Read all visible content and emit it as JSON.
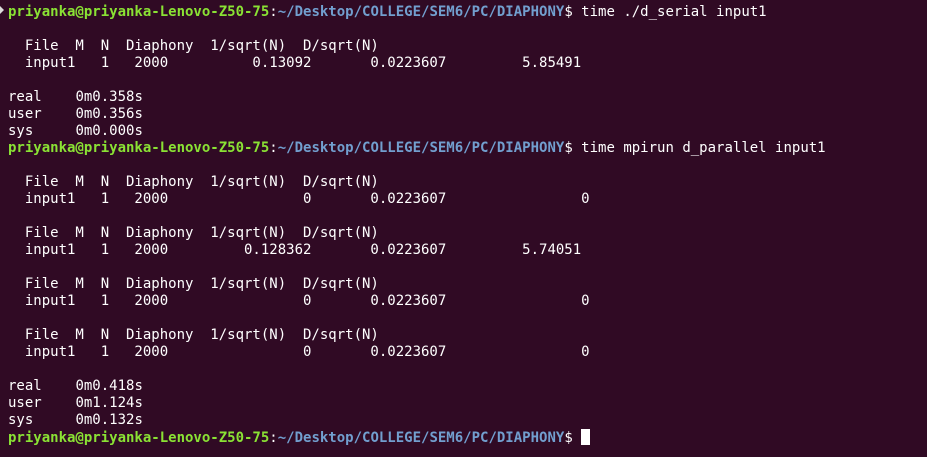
{
  "terminal": {
    "lines": [
      {
        "type": "prompt",
        "user": "priyanka@priyanka-Lenovo-Z50-75",
        "sep": ":",
        "path": "~/Desktop/COLLEGE/SEM6/PC/DIAPHONY",
        "dollar": "$ ",
        "cmd": "time ./d_serial input1"
      },
      {
        "type": "text",
        "text": ""
      },
      {
        "type": "text",
        "text": "  File  M  N  Diaphony  1/sqrt(N)  D/sqrt(N)"
      },
      {
        "type": "text",
        "text": "  input1   1   2000          0.13092       0.0223607         5.85491"
      },
      {
        "type": "text",
        "text": ""
      },
      {
        "type": "text",
        "text": "real\t0m0.358s"
      },
      {
        "type": "text",
        "text": "user\t0m0.356s"
      },
      {
        "type": "text",
        "text": "sys\t0m0.000s"
      },
      {
        "type": "prompt",
        "user": "priyanka@priyanka-Lenovo-Z50-75",
        "sep": ":",
        "path": "~/Desktop/COLLEGE/SEM6/PC/DIAPHONY",
        "dollar": "$ ",
        "cmd": "time mpirun d_parallel input1"
      },
      {
        "type": "text",
        "text": ""
      },
      {
        "type": "text",
        "text": "  File  M  N  Diaphony  1/sqrt(N)  D/sqrt(N)"
      },
      {
        "type": "text",
        "text": "  input1   1   2000                0       0.0223607                0"
      },
      {
        "type": "text",
        "text": ""
      },
      {
        "type": "text",
        "text": "  File  M  N  Diaphony  1/sqrt(N)  D/sqrt(N)"
      },
      {
        "type": "text",
        "text": "  input1   1   2000         0.128362       0.0223607         5.74051"
      },
      {
        "type": "text",
        "text": ""
      },
      {
        "type": "text",
        "text": "  File  M  N  Diaphony  1/sqrt(N)  D/sqrt(N)"
      },
      {
        "type": "text",
        "text": "  input1   1   2000                0       0.0223607                0"
      },
      {
        "type": "text",
        "text": ""
      },
      {
        "type": "text",
        "text": "  File  M  N  Diaphony  1/sqrt(N)  D/sqrt(N)"
      },
      {
        "type": "text",
        "text": "  input1   1   2000                0       0.0223607                0"
      },
      {
        "type": "text",
        "text": ""
      },
      {
        "type": "text",
        "text": "real\t0m0.418s"
      },
      {
        "type": "text",
        "text": "user\t0m1.124s"
      },
      {
        "type": "text",
        "text": "sys\t0m0.132s"
      },
      {
        "type": "prompt",
        "user": "priyanka@priyanka-Lenovo-Z50-75",
        "sep": ":",
        "path": "~/Desktop/COLLEGE/SEM6/PC/DIAPHONY",
        "dollar": "$ ",
        "cmd": "",
        "cursor": true
      }
    ]
  },
  "colors": {
    "background": "#300a24",
    "user": "#8ae234",
    "path": "#729fcf",
    "text": "#ffffff"
  }
}
